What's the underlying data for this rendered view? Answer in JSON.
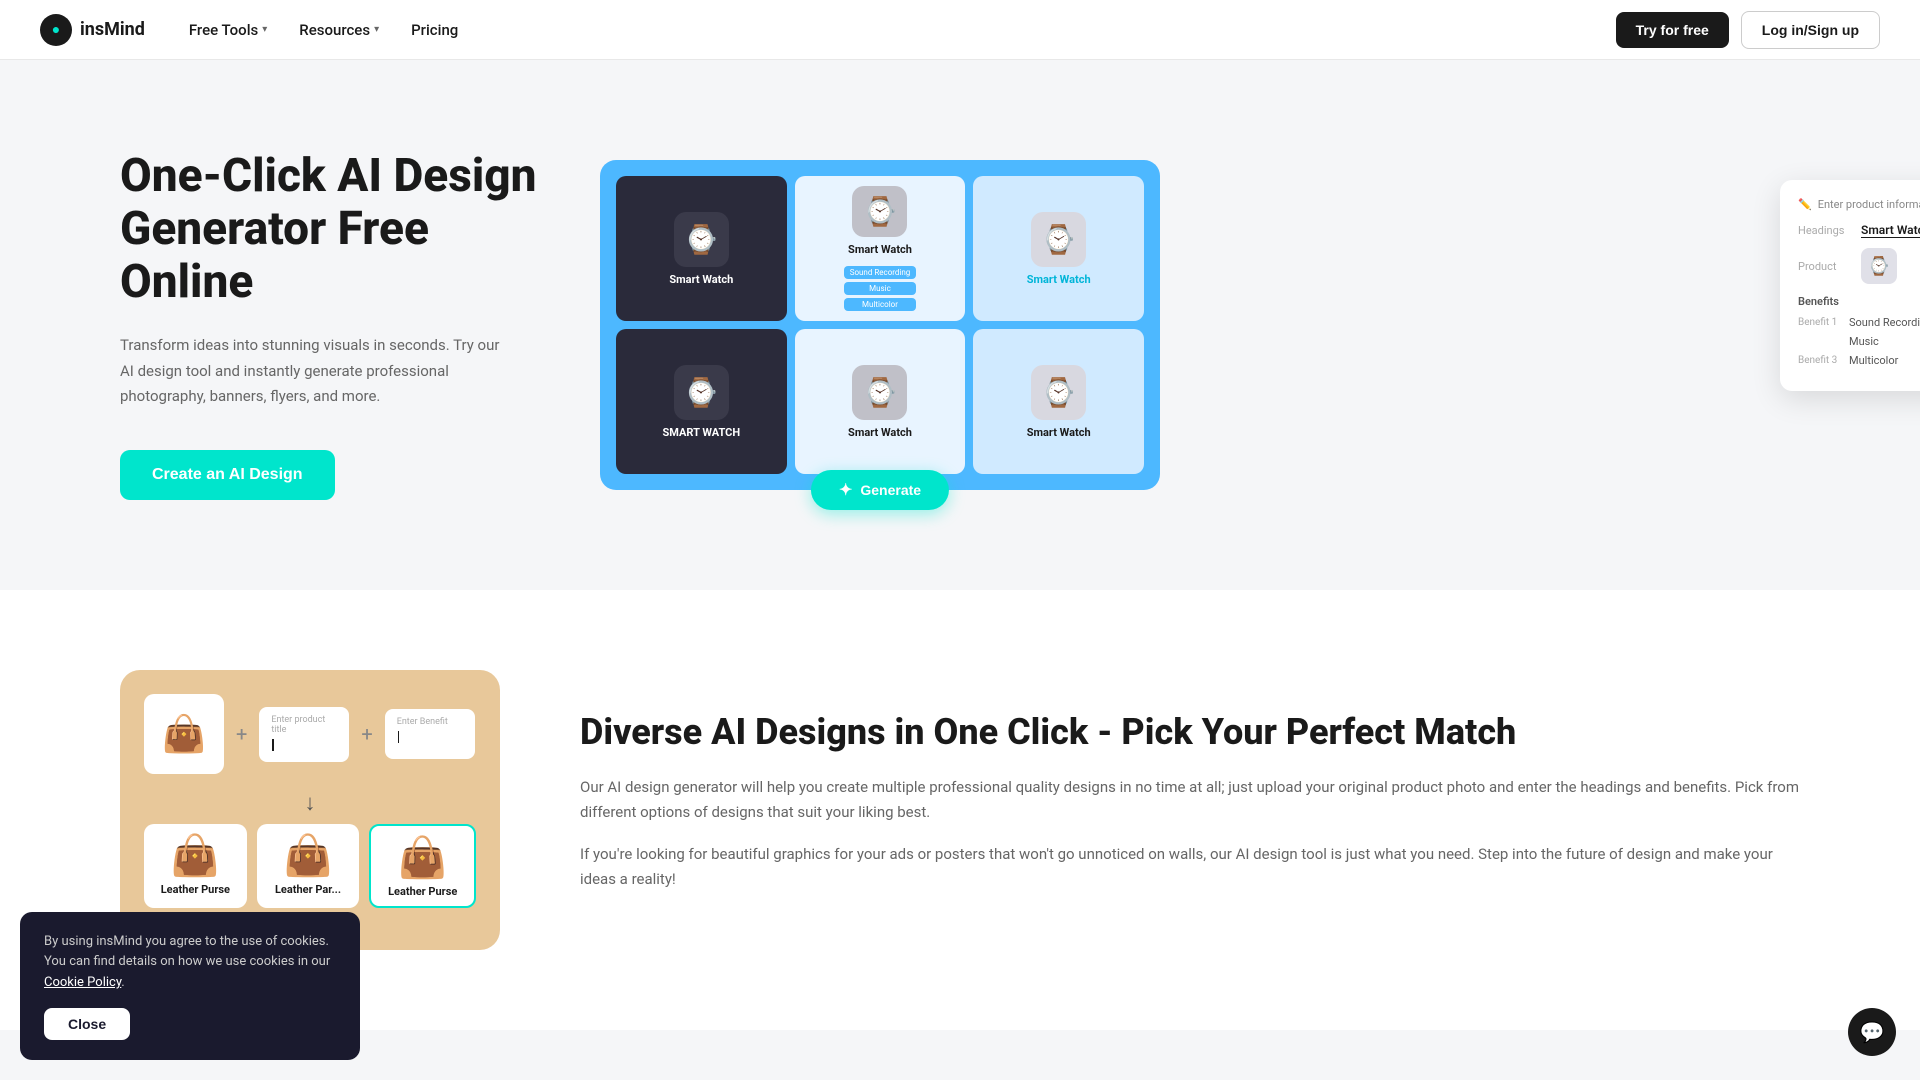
{
  "brand": {
    "name": "insMind",
    "logo_alt": "insMind logo"
  },
  "nav": {
    "links": [
      {
        "label": "Free Tools",
        "has_dropdown": true
      },
      {
        "label": "Resources",
        "has_dropdown": true
      },
      {
        "label": "Pricing",
        "has_dropdown": false
      }
    ],
    "cta_try": "Try for free",
    "cta_login": "Log in/Sign up"
  },
  "hero": {
    "title": "One-Click AI Design Generator Free Online",
    "description": "Transform ideas into stunning visuals in seconds. Try our AI design tool and instantly generate professional photography, banners, flyers, and more.",
    "cta_button": "Create an AI Design",
    "visual": {
      "watches": [
        {
          "label": "Smart Watch",
          "bg": "dark",
          "id": "w1"
        },
        {
          "label": "Smart Watch",
          "bg": "blue",
          "id": "w2"
        },
        {
          "label": "Smart Watch",
          "bg": "light",
          "id": "w3"
        },
        {
          "label": "SMART WATCH",
          "bg": "dark2",
          "id": "w4"
        },
        {
          "label": "Smart Watch",
          "bg": "white",
          "id": "w5"
        },
        {
          "label": "Smart Watch",
          "bg": "blue2",
          "id": "w6"
        }
      ],
      "side_panel": {
        "title": "Enter product information",
        "heading_label": "Headings",
        "heading_value": "Smart Watch",
        "product_label": "Product",
        "benefits_label": "Benefits",
        "benefits": [
          {
            "num": "Benefit 1",
            "value": "Sound Recording"
          },
          {
            "num": "",
            "value": "Music"
          },
          {
            "num": "Benefit 3",
            "value": "Multicolor"
          }
        ]
      },
      "generate_button": "Generate"
    }
  },
  "section2": {
    "title": "Diverse AI Designs in One Click - Pick Your Perfect Match",
    "desc1": "Our AI design generator will help you create multiple professional quality designs in no time at all; just upload your original product photo and enter the headings and benefits. Pick from different options of designs that suit your liking best.",
    "desc2": "If you're looking for beautiful graphics for your ads or posters that won't go unnoticed on walls, our AI design tool is just what you need. Step into the future of design and make your ideas a reality!",
    "demo": {
      "input_label1": "Enter product title",
      "input_label2": "Enter Benefit",
      "results": [
        {
          "label": "Leather Purse",
          "selected": false
        },
        {
          "label": "Leather Par...",
          "selected": false
        },
        {
          "label": "Leather Purse",
          "selected": true
        }
      ]
    }
  },
  "cookie": {
    "text": "By using insMind you agree to the use of cookies. You can find details on how we use cookies in our",
    "link_text": "Cookie Policy",
    "close_label": "Close"
  },
  "chat": {
    "icon": "💬"
  }
}
